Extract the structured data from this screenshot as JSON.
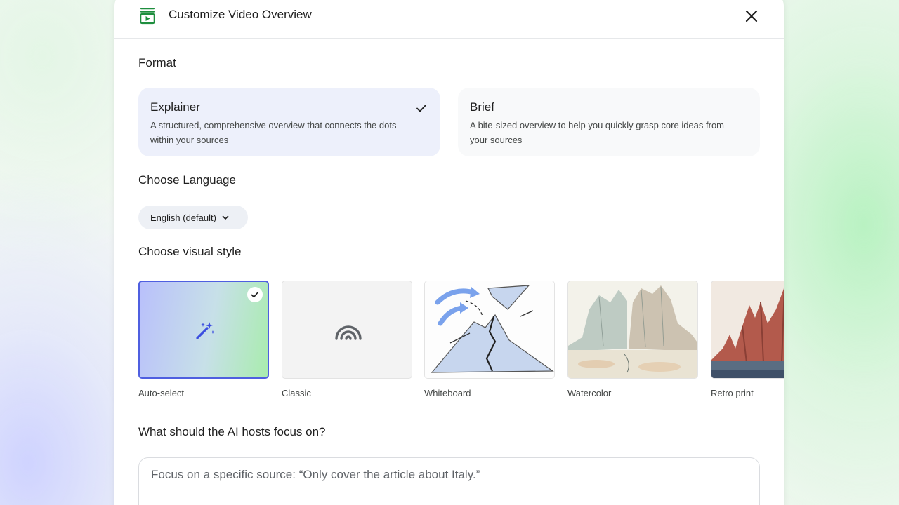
{
  "dialog": {
    "title": "Customize Video Overview",
    "app_icon": "video-overview-icon",
    "close_icon": "close-icon"
  },
  "format": {
    "label": "Format",
    "options": [
      {
        "title": "Explainer",
        "description": "A structured, comprehensive overview that connects the dots within your sources",
        "selected": true
      },
      {
        "title": "Brief",
        "description": "A bite-sized overview to help you quickly grasp core ideas from your sources",
        "selected": false
      }
    ]
  },
  "language": {
    "label": "Choose Language",
    "selected": "English (default)",
    "icon": "chevron-down-icon"
  },
  "visual_style": {
    "label": "Choose visual style",
    "options": [
      {
        "name": "Auto-select",
        "icon": "magic-wand-icon",
        "selected": true
      },
      {
        "name": "Classic",
        "icon": "rainbow-arc-icon",
        "selected": false
      },
      {
        "name": "Whiteboard",
        "selected": false
      },
      {
        "name": "Watercolor",
        "selected": false
      },
      {
        "name": "Retro print",
        "selected": false
      }
    ]
  },
  "focus": {
    "label": "What should the AI hosts focus on?",
    "placeholder": "Focus on a specific source: “Only cover the article about Italy.”"
  },
  "colors": {
    "accent_blue": "#4f5fe0",
    "selected_card_bg": "#edf0fb",
    "app_icon_green": "#1e8e3e"
  }
}
